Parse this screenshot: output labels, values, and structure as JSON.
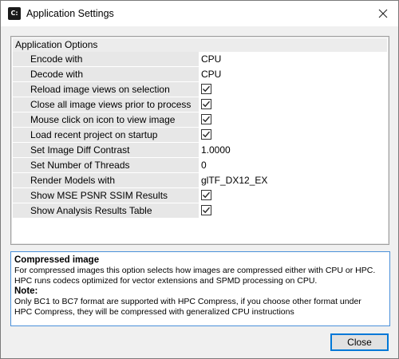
{
  "window": {
    "title": "Application Settings",
    "app_icon_text": "C:"
  },
  "options": {
    "group_title": "Application Options",
    "rows": [
      {
        "label": "Encode with",
        "type": "text",
        "value": "CPU"
      },
      {
        "label": "Decode with",
        "type": "text",
        "value": "CPU"
      },
      {
        "label": "Reload image views on selection",
        "type": "checkbox",
        "checked": true
      },
      {
        "label": "Close all image views prior to process",
        "type": "checkbox",
        "checked": true
      },
      {
        "label": "Mouse click on icon to view image",
        "type": "checkbox",
        "checked": true
      },
      {
        "label": "Load recent project on startup",
        "type": "checkbox",
        "checked": true
      },
      {
        "label": "Set Image Diff Contrast",
        "type": "text",
        "value": "1.0000"
      },
      {
        "label": "Set Number of Threads",
        "type": "text",
        "value": "0"
      },
      {
        "label": "Render Models with",
        "type": "text",
        "value": "glTF_DX12_EX"
      },
      {
        "label": "Show MSE PSNR SSIM Results",
        "type": "checkbox",
        "checked": true
      },
      {
        "label": "Show Analysis Results Table",
        "type": "checkbox",
        "checked": true
      }
    ]
  },
  "help": {
    "title": "Compressed image",
    "line1": "For compressed images this option selects how images are compressed either with CPU or HPC.",
    "line2": "HPC runs codecs optimized for vector extensions and SPMD processing on CPU.",
    "note_title": "Note:",
    "note_line1": "Only BC1 to BC7 format are supported with HPC Compress, if you choose other format under",
    "note_line2": "HPC Compress, they will be compressed with generalized CPU instructions"
  },
  "buttons": {
    "close_label": "Close"
  },
  "colors": {
    "accent": "#0078d7",
    "help_border": "#4a90d9",
    "row_gray": "#e7e7e7"
  }
}
